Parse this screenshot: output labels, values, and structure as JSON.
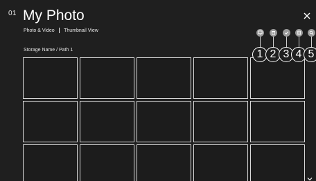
{
  "step_number": "01",
  "header": {
    "title": "My Photo",
    "filter_label": "Photo & Video",
    "view_label": "Thumbnail View"
  },
  "path": "Storage Name / Path 1",
  "toolbar": {
    "buttons": [
      {
        "icon": "display-icon",
        "callout": "1"
      },
      {
        "icon": "delete-icon",
        "callout": "2"
      },
      {
        "icon": "check-icon",
        "callout": "3"
      },
      {
        "icon": "copy-icon",
        "callout": "4"
      },
      {
        "icon": "search-icon",
        "callout": "5"
      }
    ]
  },
  "icons": {
    "close": "close-icon",
    "scroll_down": "chevron-down-icon"
  }
}
